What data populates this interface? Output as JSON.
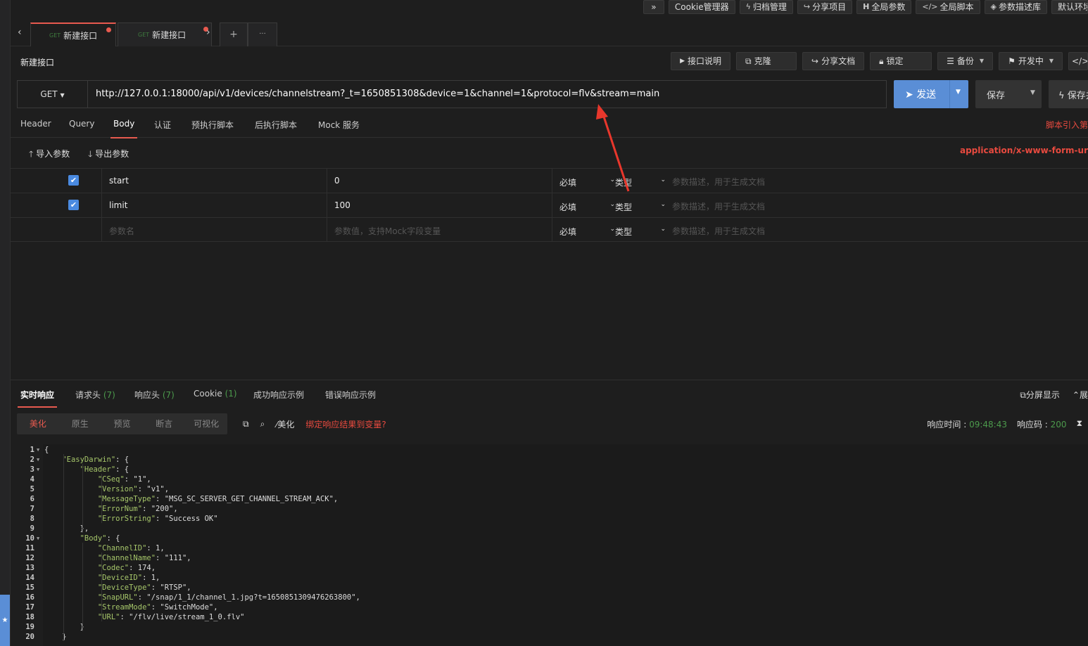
{
  "toolbar": {
    "expand": "»",
    "cookie": "Cookie管理器",
    "archive": "归档管理",
    "share_project": "分享项目",
    "global_params": "全局参数",
    "global_script": "全局脚本",
    "param_lib": "参数描述库",
    "default_env": "默认环境"
  },
  "tabs": [
    {
      "method": "GET",
      "label": "新建接口"
    },
    {
      "method": "GET",
      "label": "新建接口"
    }
  ],
  "tab_controls": {
    "prev": "‹",
    "next": "›",
    "add": "+",
    "more": "···"
  },
  "request": {
    "title": "新建接口",
    "actions": {
      "doc": "接口说明",
      "clone": "克隆",
      "share_doc": "分享文档",
      "lock": "锁定",
      "backup": "备份",
      "status": "开发中",
      "code": "</>"
    },
    "method": "GET",
    "url": "http://127.0.0.1:18000/api/v1/devices/channelstream?_t=1650851308&device=1&channel=1&protocol=flv&stream=main",
    "send_label": "发送",
    "save_label": "保存",
    "save_open_label": "保存并"
  },
  "subtabs": [
    "Header",
    "Query",
    "Body",
    "认证",
    "预执行脚本",
    "后执行脚本",
    "Mock 服务"
  ],
  "script_link": "脚本引入第",
  "body": {
    "import_label": "导入参数",
    "export_label": "导出参数",
    "content_type": "application/x-www-form-ur"
  },
  "params": [
    {
      "name": "start",
      "value": "0",
      "required": "必填",
      "type": "类型",
      "desc": "参数描述，用于生成文档"
    },
    {
      "name": "limit",
      "value": "100",
      "required": "必填",
      "type": "类型",
      "desc": "参数描述，用于生成文档"
    }
  ],
  "param_placeholder": {
    "name": "参数名",
    "value": "参数值，支持Mock字段变量",
    "required": "必填",
    "type": "类型",
    "desc": "参数描述，用于生成文档"
  },
  "response": {
    "tabs": [
      {
        "label": "实时响应",
        "count": ""
      },
      {
        "label": "请求头",
        "count": "(7)"
      },
      {
        "label": "响应头",
        "count": "(7)"
      },
      {
        "label": "Cookie",
        "count": "(1)"
      },
      {
        "label": "成功响应示例",
        "count": ""
      },
      {
        "label": "错误响应示例",
        "count": ""
      }
    ],
    "split_label": "分屏显示",
    "expand_label": "展",
    "views": [
      "美化",
      "原生",
      "预览",
      "断言",
      "可视化"
    ],
    "beautify_label": "美化",
    "bind_label": "绑定响应结果到变量?",
    "time_label": "响应时间 :",
    "time_value": "09:48:43",
    "code_label": "响应码 :",
    "code_value": "200"
  },
  "code_lines": [
    "{",
    "    \"EasyDarwin\": {",
    "        \"Header\": {",
    "            \"CSeq\": \"1\",",
    "            \"Version\": \"v1\",",
    "            \"MessageType\": \"MSG_SC_SERVER_GET_CHANNEL_STREAM_ACK\",",
    "            \"ErrorNum\": \"200\",",
    "            \"ErrorString\": \"Success OK\"",
    "        },",
    "        \"Body\": {",
    "            \"ChannelID\": 1,",
    "            \"ChannelName\": \"111\",",
    "            \"Codec\": 174,",
    "            \"DeviceID\": 1,",
    "            \"DeviceType\": \"RTSP\",",
    "            \"SnapURL\": \"/snap/1_1/channel_1.jpg?t=1650851309476263800\",",
    "            \"StreamMode\": \"SwitchMode\",",
    "            \"URL\": \"/flv/live/stream_1_0.flv\"",
    "        }",
    "    }"
  ],
  "folded_lines": [
    1,
    2,
    3,
    10
  ],
  "colors": {
    "accent": "#e85a4f",
    "primary": "#5a8ed6",
    "success": "#4c9a4c",
    "danger": "#e84a3f"
  }
}
